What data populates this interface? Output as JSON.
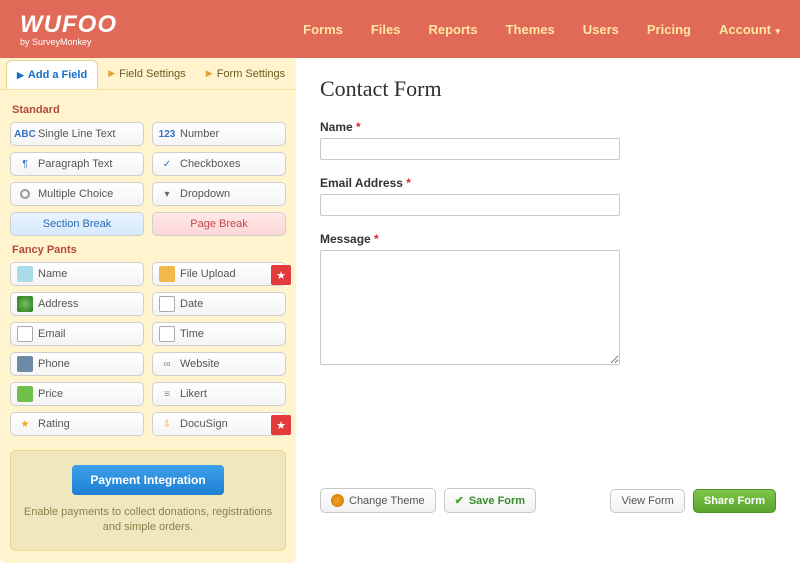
{
  "header": {
    "logo_main": "WUFOO",
    "logo_sub": "by SurveyMonkey",
    "nav": [
      "Forms",
      "Files",
      "Reports",
      "Themes",
      "Users",
      "Pricing"
    ],
    "account": "Account"
  },
  "tabs": {
    "add": "Add a Field",
    "field_settings": "Field Settings",
    "form_settings": "Form Settings"
  },
  "groups": {
    "standard": "Standard",
    "fancy": "Fancy Pants"
  },
  "fields": {
    "single_line": "Single Line Text",
    "paragraph": "Paragraph Text",
    "multiple_choice": "Multiple Choice",
    "number": "Number",
    "checkboxes": "Checkboxes",
    "dropdown": "Dropdown",
    "section_break": "Section Break",
    "page_break": "Page Break",
    "name": "Name",
    "address": "Address",
    "email": "Email",
    "phone": "Phone",
    "price": "Price",
    "rating": "Rating",
    "file_upload": "File Upload",
    "date": "Date",
    "time": "Time",
    "website": "Website",
    "likert": "Likert",
    "docusign": "DocuSign"
  },
  "payment": {
    "button": "Payment Integration",
    "desc": "Enable payments to collect donations, registrations and simple orders."
  },
  "form": {
    "title": "Contact Form",
    "labels": {
      "name": "Name",
      "email": "Email Address",
      "message": "Message"
    }
  },
  "buttons": {
    "change_theme": "Change Theme",
    "save_form": "Save Form",
    "view_form": "View Form",
    "share_form": "Share Form"
  }
}
